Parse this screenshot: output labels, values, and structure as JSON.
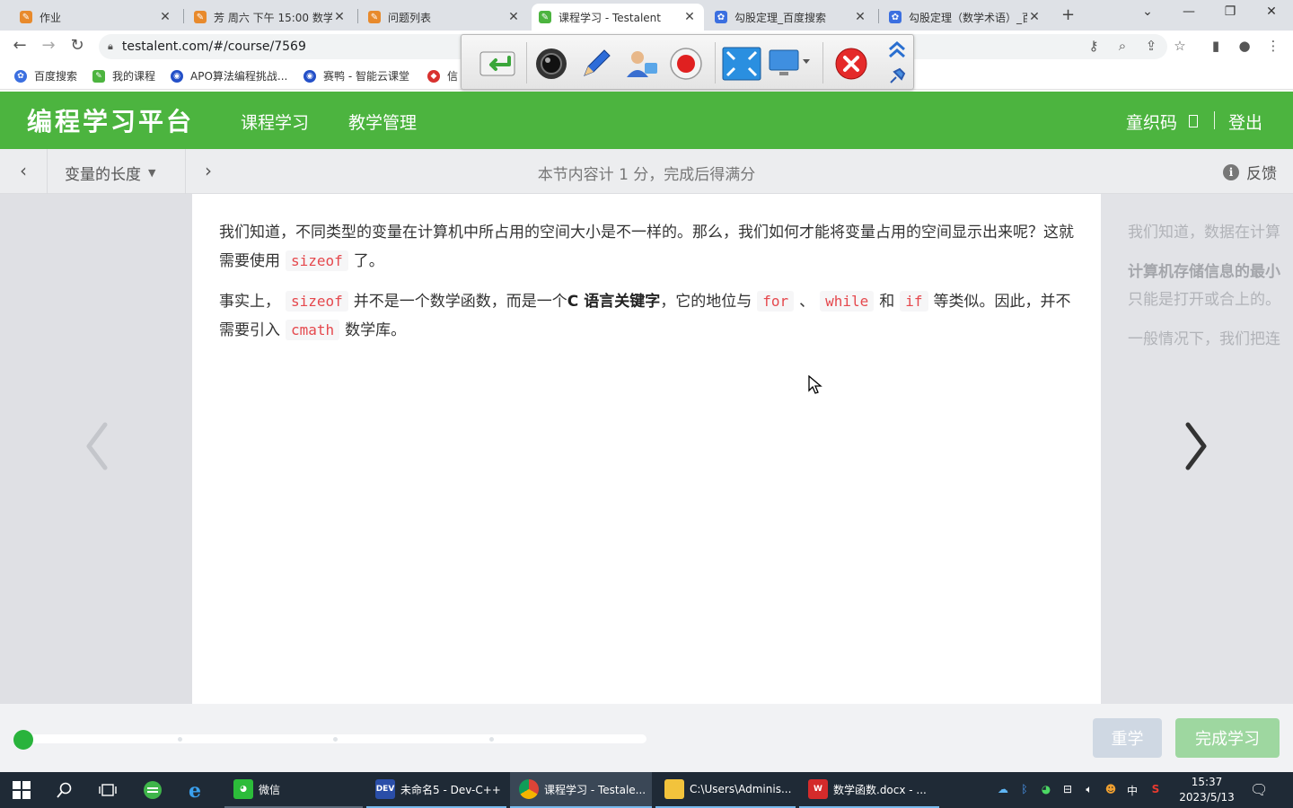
{
  "browser": {
    "tabs": [
      {
        "title": "作业",
        "active": false
      },
      {
        "title": "芳 周六 下午 15:00 数学",
        "active": false
      },
      {
        "title": "问题列表",
        "active": false
      },
      {
        "title": "课程学习 - Testalent",
        "active": true
      },
      {
        "title": "勾股定理_百度搜索",
        "active": false
      },
      {
        "title": "勾股定理（数学术语）_百",
        "active": false
      }
    ],
    "url": "testalent.com/#/course/7569",
    "bookmarks": [
      {
        "label": "百度搜索"
      },
      {
        "label": "我的课程"
      },
      {
        "label": "APO算法编程挑战..."
      },
      {
        "label": "赛鸭 - 智能云课堂"
      },
      {
        "label": "信"
      }
    ]
  },
  "app": {
    "logo": "编程学习平台",
    "nav": [
      "课程学习",
      "教学管理"
    ],
    "user_name": "童织码",
    "logout": "登出",
    "accent_color": "#4cb43f"
  },
  "lesson": {
    "title": "变量的长度",
    "score_note": "本节内容计 1 分，完成后得满分",
    "feedback": "反馈",
    "paragraph1_a": "我们知道，不同类型的变量在计算机中所占用的空间大小是不一样的。那么，我们如何才能将变量占用的空间显示出来呢？这就需要使用",
    "paragraph1_code": "sizeof",
    "paragraph1_b": "了。",
    "p2_a": "事实上，",
    "p2_code1": "sizeof",
    "p2_b": "并不是一个数学函数，而是一个",
    "p2_bold": "C 语言关键字",
    "p2_c": "，它的地位与",
    "p2_code2": "for",
    "p2_d": "、",
    "p2_code3": "while",
    "p2_e": "和",
    "p2_code4": "if",
    "p2_f": "等类似。因此，并不需要引入",
    "p2_code5": "cmath",
    "p2_g": "数学库。",
    "next_preview": [
      "我们知道，数据在计算",
      "计算机存储信息的最小",
      "只能是打开或合上的。",
      "一般情况下，我们把连"
    ]
  },
  "footer": {
    "relearn": "重学",
    "complete": "完成学习",
    "progress": 0
  },
  "taskbar": {
    "apps": [
      {
        "label": "微信"
      },
      {
        "label": "未命名5 - Dev-C++"
      },
      {
        "label": "课程学习 - Testale..."
      },
      {
        "label": "C:\\Users\\Adminis..."
      },
      {
        "label": "数学函数.docx - ..."
      }
    ],
    "ime": "中",
    "time": "15:37",
    "date": "2023/5/13"
  }
}
